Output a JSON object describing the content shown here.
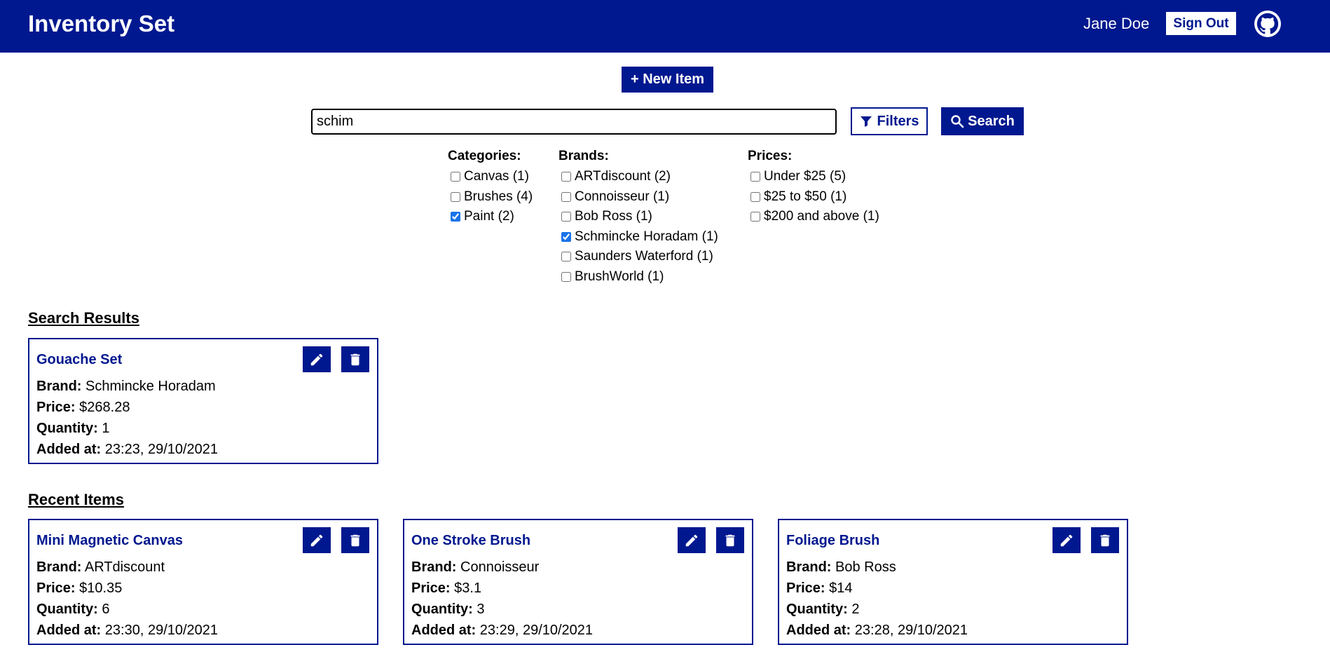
{
  "header": {
    "title": "Inventory Set",
    "user_name": "Jane Doe",
    "sign_out_label": "Sign Out",
    "github_icon": "github-icon"
  },
  "actions": {
    "new_item_label": "+ New Item",
    "filters_label": "Filters",
    "search_label": "Search"
  },
  "search": {
    "value": "schim"
  },
  "filters": {
    "categories": {
      "heading": "Categories:",
      "options": [
        {
          "label": "Canvas (1)",
          "checked": false
        },
        {
          "label": "Brushes (4)",
          "checked": false
        },
        {
          "label": "Paint (2)",
          "checked": true
        }
      ]
    },
    "brands": {
      "heading": "Brands:",
      "options": [
        {
          "label": "ARTdiscount (2)",
          "checked": false
        },
        {
          "label": "Connoisseur (1)",
          "checked": false
        },
        {
          "label": "Bob Ross (1)",
          "checked": false
        },
        {
          "label": "Schmincke Horadam (1)",
          "checked": true
        },
        {
          "label": "Saunders Waterford (1)",
          "checked": false
        },
        {
          "label": "BrushWorld (1)",
          "checked": false
        }
      ]
    },
    "prices": {
      "heading": "Prices:",
      "options": [
        {
          "label": "Under $25 (5)",
          "checked": false
        },
        {
          "label": "$25 to $50 (1)",
          "checked": false
        },
        {
          "label": "$200 and above (1)",
          "checked": false
        }
      ]
    }
  },
  "field_labels": {
    "brand": "Brand:",
    "price": "Price:",
    "quantity": "Quantity:",
    "added_at": "Added at:"
  },
  "search_results": {
    "title": "Search Results",
    "items": [
      {
        "name": "Gouache Set",
        "brand": "Schmincke Horadam",
        "price": "$268.28",
        "quantity": "1",
        "added_at": "23:23, 29/10/2021"
      }
    ]
  },
  "recent_items": {
    "title": "Recent Items",
    "items": [
      {
        "name": "Mini Magnetic Canvas",
        "brand": "ARTdiscount",
        "price": "$10.35",
        "quantity": "6",
        "added_at": "23:30, 29/10/2021"
      },
      {
        "name": "One Stroke Brush",
        "brand": "Connoisseur",
        "price": "$3.1",
        "quantity": "3",
        "added_at": "23:29, 29/10/2021"
      },
      {
        "name": "Foliage Brush",
        "brand": "Bob Ross",
        "price": "$14",
        "quantity": "2",
        "added_at": "23:28, 29/10/2021"
      }
    ]
  },
  "colors": {
    "primary": "#00188f",
    "checkbox_checked": "#1a73e8"
  }
}
